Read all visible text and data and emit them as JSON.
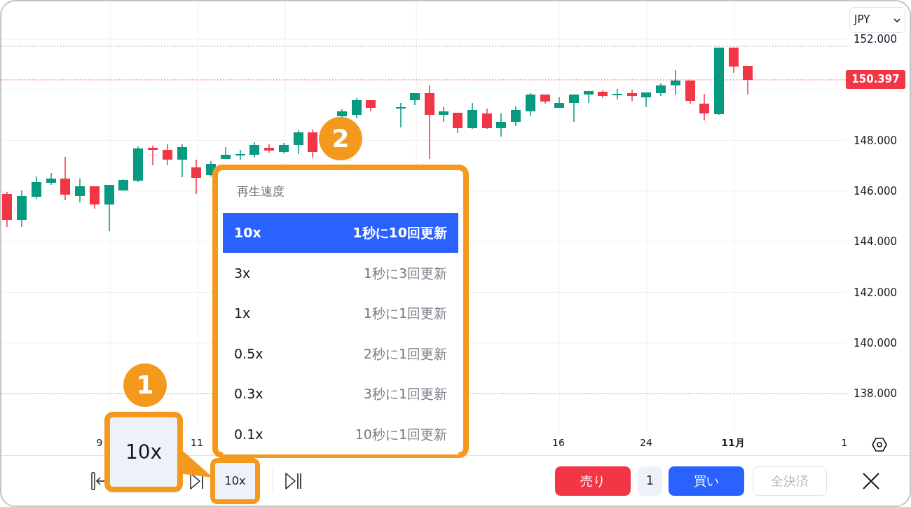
{
  "currency_select": {
    "value": "JPY"
  },
  "price_axis": {
    "ticks": [
      "152.000",
      "148.000",
      "146.000",
      "144.000",
      "142.000",
      "140.000",
      "138.000"
    ],
    "current_price": "150.397"
  },
  "time_axis": {
    "labels": [
      {
        "text": "9",
        "kind": "day"
      },
      {
        "text": "11",
        "kind": "day"
      },
      {
        "text": "16",
        "kind": "day"
      },
      {
        "text": "24",
        "kind": "day"
      },
      {
        "text": "11月",
        "kind": "month"
      },
      {
        "text": "1",
        "kind": "day"
      }
    ]
  },
  "speed_menu": {
    "title": "再生速度",
    "items": [
      {
        "speed": "10x",
        "description": "1秒に10回更新",
        "selected": true
      },
      {
        "speed": "3x",
        "description": "1秒に3回更新",
        "selected": false
      },
      {
        "speed": "1x",
        "description": "1秒に1回更新",
        "selected": false
      },
      {
        "speed": "0.5x",
        "description": "2秒に1回更新",
        "selected": false
      },
      {
        "speed": "0.3x",
        "description": "3秒に1回更新",
        "selected": false
      },
      {
        "speed": "0.1x",
        "description": "10秒に1回更新",
        "selected": false
      }
    ]
  },
  "playback_bar": {
    "speed_button": "10x"
  },
  "trade_bar": {
    "sell": "売り",
    "quantity": "1",
    "buy": "買い",
    "close_all": {
      "label": "全決済",
      "disabled": true
    }
  },
  "annotations": [
    {
      "number": "1"
    },
    {
      "number": "2"
    }
  ],
  "callout": {
    "text": "10x"
  }
}
